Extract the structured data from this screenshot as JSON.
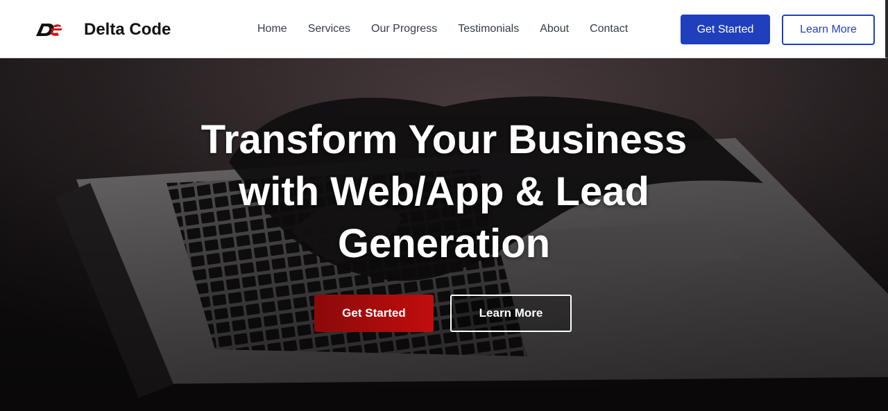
{
  "brand": {
    "name": "Delta Code",
    "logo_icon": "delta-code-logo-icon",
    "logo_colors": {
      "primary": "#111111",
      "accent": "#d01414"
    }
  },
  "nav": {
    "items": [
      {
        "label": "Home"
      },
      {
        "label": "Services"
      },
      {
        "label": "Our Progress"
      },
      {
        "label": "Testimonials"
      },
      {
        "label": "About"
      },
      {
        "label": "Contact"
      }
    ],
    "get_started_label": "Get Started",
    "learn_more_label": "Learn More"
  },
  "hero": {
    "title_lines": [
      "Transform Your Business",
      "with Web/App & Lead",
      "Generation"
    ],
    "background": "laptop-typing-photo",
    "get_started_label": "Get Started",
    "learn_more_label": "Learn More"
  },
  "colors": {
    "nav_primary_button": "#1f3fbd",
    "hero_primary_button": "#c20d0d",
    "hero_overlay": "#1a1718",
    "text_dark": "#111111",
    "nav_text": "#333c4a"
  }
}
